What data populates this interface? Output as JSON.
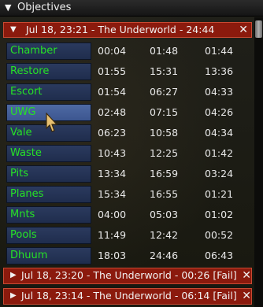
{
  "window": {
    "title": "Objectives"
  },
  "runs": [
    {
      "label": "Jul 18, 23:21 - The Underworld - 24:44",
      "expanded": true
    },
    {
      "label": "Jul 18, 23:20 - The Underworld - 00:26 [Fail]",
      "expanded": false
    },
    {
      "label": "Jul 18, 23:14 - The Underworld - 06:14 [Fail]",
      "expanded": false
    }
  ],
  "objectives": [
    {
      "name": "Chamber",
      "t1": "00:04",
      "t2": "01:48",
      "t3": "01:44"
    },
    {
      "name": "Restore",
      "t1": "01:55",
      "t2": "15:31",
      "t3": "13:36"
    },
    {
      "name": "Escort",
      "t1": "01:54",
      "t2": "06:27",
      "t3": "04:33"
    },
    {
      "name": "UWG",
      "t1": "02:48",
      "t2": "07:15",
      "t3": "04:26"
    },
    {
      "name": "Vale",
      "t1": "06:23",
      "t2": "10:58",
      "t3": "04:34"
    },
    {
      "name": "Waste",
      "t1": "10:43",
      "t2": "12:25",
      "t3": "01:42"
    },
    {
      "name": "Pits",
      "t1": "13:34",
      "t2": "16:59",
      "t3": "03:24"
    },
    {
      "name": "Planes",
      "t1": "15:34",
      "t2": "16:55",
      "t3": "01:21"
    },
    {
      "name": "Mnts",
      "t1": "04:00",
      "t2": "05:03",
      "t3": "01:02"
    },
    {
      "name": "Pools",
      "t1": "11:49",
      "t2": "12:42",
      "t3": "00:52"
    },
    {
      "name": "Dhuum",
      "t1": "18:03",
      "t2": "24:46",
      "t3": "06:43"
    }
  ],
  "icons": {
    "expand": "triangle-down-icon",
    "collapse": "triangle-right-icon",
    "close": "close-icon"
  },
  "colors": {
    "run_header": "#8b1a0d",
    "objective_text": "#26e226",
    "button": "#22315a",
    "button_hover": "#4a65a0"
  }
}
